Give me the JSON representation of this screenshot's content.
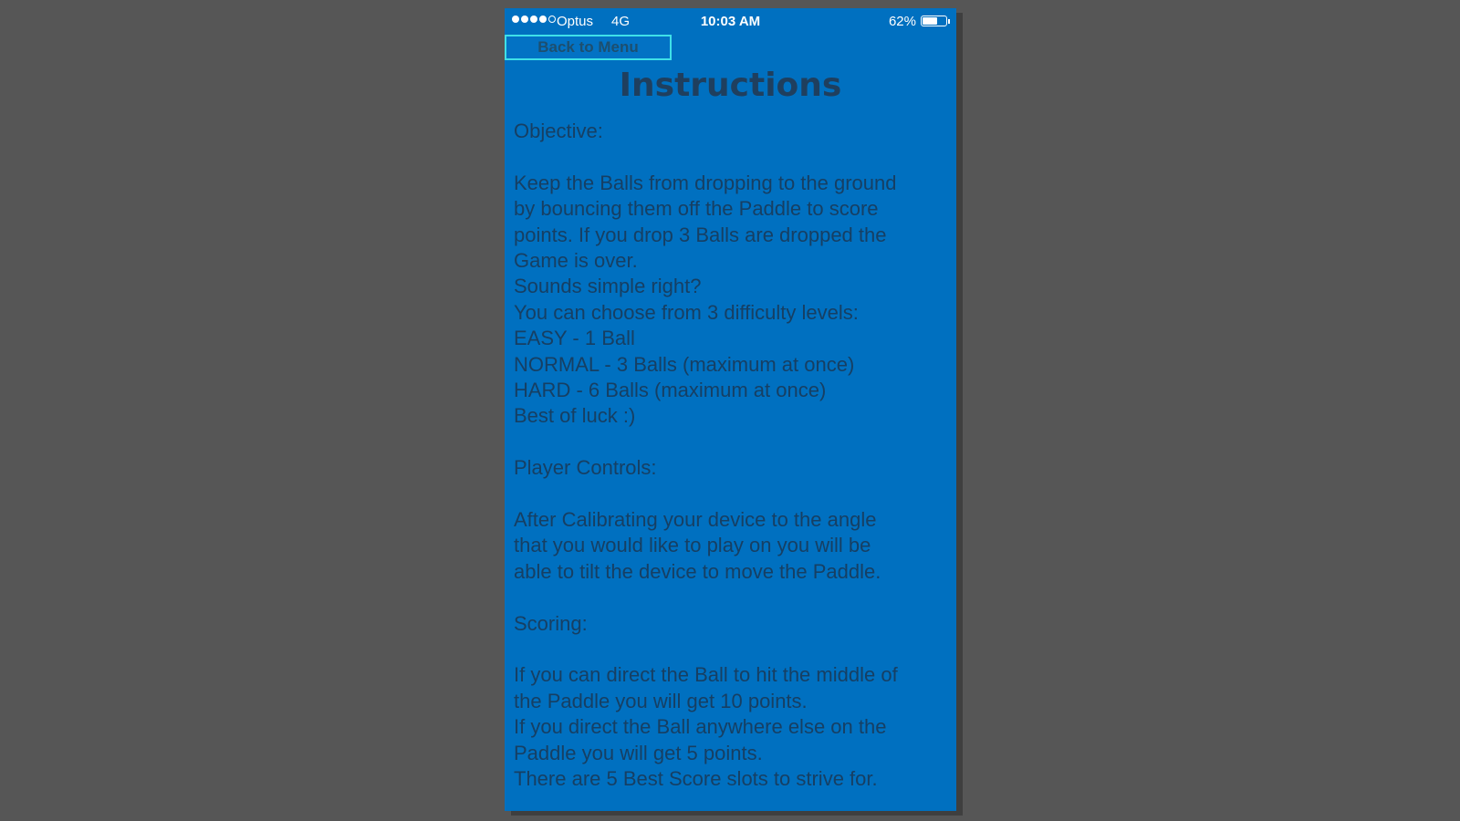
{
  "status_bar": {
    "carrier": "Optus",
    "network": "4G",
    "time": "10:03 AM",
    "battery": "62%",
    "battery_level": 0.62,
    "signal_bars_filled": 4,
    "signal_bars_total": 5
  },
  "back_button": {
    "label": "Back to Menu"
  },
  "title": "Instructions",
  "sections": {
    "objective": {
      "heading": "Objective:",
      "lines": [
        "Keep the Balls from dropping to the ground",
        "by bouncing them off the Paddle to score",
        "points. If you drop 3 Balls are dropped the",
        "Game is over.",
        "Sounds simple right?",
        "You can choose from 3 difficulty levels:",
        "EASY - 1 Ball",
        "NORMAL - 3 Balls (maximum at once)",
        "HARD - 6 Balls (maximum at once)",
        "Best of luck :)"
      ]
    },
    "controls": {
      "heading": "Player Controls:",
      "lines": [
        "After Calibrating your device to the angle",
        "that you would like to play on you will be",
        "able to tilt the device to move the Paddle."
      ]
    },
    "scoring": {
      "heading": "Scoring:",
      "lines": [
        "If you can direct the Ball to hit the middle of",
        "the Paddle you will get 10 points.",
        "If you direct the Ball anywhere else on the",
        "Paddle you will get 5 points.",
        "There are 5 Best Score slots to strive for."
      ]
    }
  }
}
